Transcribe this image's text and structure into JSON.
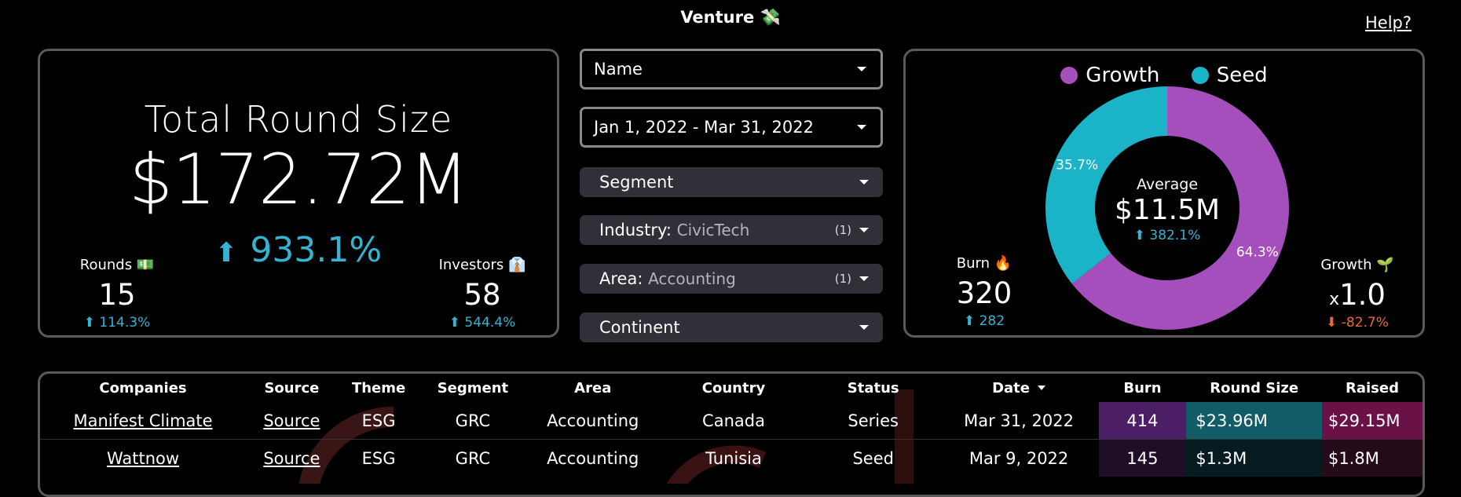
{
  "app": {
    "title": "Venture 💸",
    "help_label": "Help?"
  },
  "kpi": {
    "title": "Total Round Size",
    "value": "$172.72M",
    "change_arrow": "⬆",
    "change": "933.1%",
    "rounds": {
      "label": "Rounds 💵",
      "value": "15",
      "delta": "⬆ 114.3%"
    },
    "investors": {
      "label": "Investors 👔",
      "value": "58",
      "delta": "⬆ 544.4%"
    }
  },
  "filters": {
    "name": {
      "label": "Name"
    },
    "date": {
      "label": "Jan 1, 2022 - Mar 31, 2022"
    },
    "segment": {
      "label": "Segment"
    },
    "industry": {
      "label": "Industry",
      "value": "CivicTech",
      "count": "(1)"
    },
    "area": {
      "label": "Area",
      "value": "Accounting",
      "count": "(1)"
    },
    "continent": {
      "label": "Continent"
    }
  },
  "donut": {
    "legend": [
      {
        "name": "Growth",
        "color": "#a54fbd"
      },
      {
        "name": "Seed",
        "color": "#1ab3c8"
      }
    ],
    "slices": [
      {
        "name": "Growth",
        "value": 64.3,
        "label": "64.3%",
        "color": "#a54fbd"
      },
      {
        "name": "Seed",
        "value": 35.7,
        "label": "35.7%",
        "color": "#1ab3c8"
      }
    ],
    "center": {
      "label": "Average",
      "value": "$11.5M",
      "delta": "⬆ 382.1%"
    },
    "burn": {
      "label": "Burn 🔥",
      "value": "320",
      "delta": "⬆ 282"
    },
    "growth": {
      "label": "Growth 🌱",
      "prefix": "x",
      "value": "1.0",
      "delta": "⬇ -82.7%"
    }
  },
  "table": {
    "headers": [
      "Companies",
      "Source",
      "Theme",
      "Segment",
      "Area",
      "Country",
      "Status",
      "Date",
      "Burn",
      "Round Size",
      "Raised"
    ],
    "sorted_column": "Date",
    "rows": [
      {
        "company": "Manifest Climate",
        "source": "Source",
        "theme": "ESG",
        "segment": "GRC",
        "area": "Accounting",
        "country": "Canada",
        "status": "Series",
        "date": "Mar 31, 2022",
        "burn": "414",
        "round_size": "$23.96M",
        "raised": "$29.15M"
      },
      {
        "company": "Wattnow",
        "source": "Source",
        "theme": "ESG",
        "segment": "GRC",
        "area": "Accounting",
        "country": "Tunisia",
        "status": "Seed",
        "date": "Mar 9, 2022",
        "burn": "145",
        "round_size": "$1.3M",
        "raised": "$1.8M"
      }
    ]
  },
  "colors": {
    "accent_up": "#34b3d3",
    "accent_down": "#e8673c",
    "growth": "#a54fbd",
    "seed": "#1ab3c8",
    "panel_border": "#5a5a5a"
  }
}
